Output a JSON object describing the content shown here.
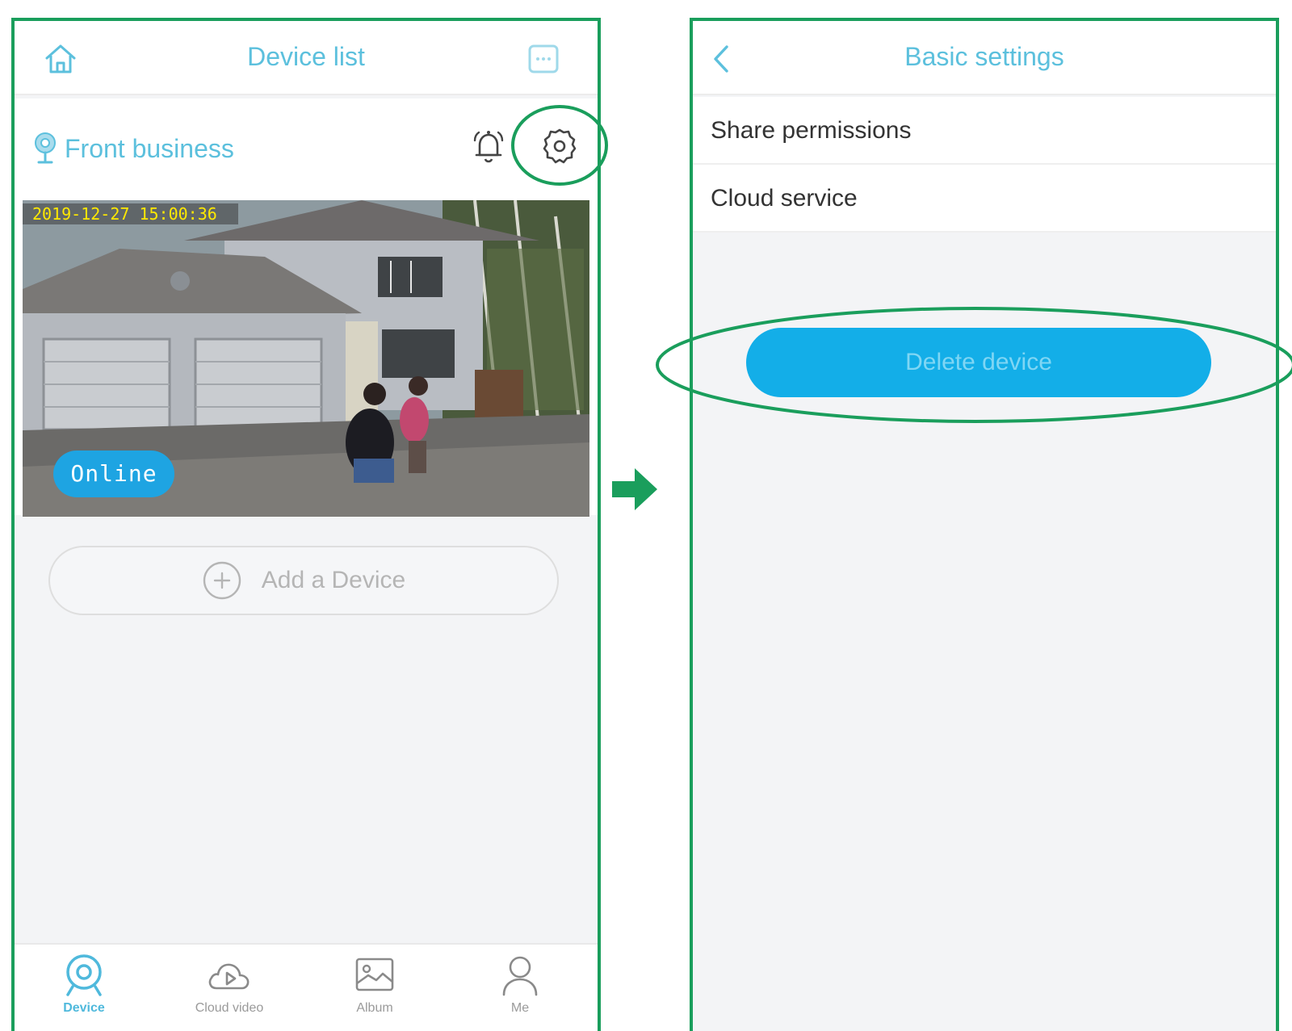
{
  "left_screen": {
    "header": {
      "title": "Device list"
    },
    "device": {
      "name": "Front business",
      "timestamp": "2019-12-27  15:00:36",
      "status": "Online"
    },
    "add_device_label": "Add a Device",
    "tabs": [
      {
        "label": "Device",
        "active": true
      },
      {
        "label": "Cloud video",
        "active": false
      },
      {
        "label": "Album",
        "active": false
      },
      {
        "label": "Me",
        "active": false
      }
    ]
  },
  "right_screen": {
    "header": {
      "title": "Basic settings"
    },
    "settings_items": [
      "Share permissions",
      "Cloud service"
    ],
    "delete_button_label": "Delete device"
  },
  "colors": {
    "accent": "#5cc0dd",
    "primary_button": "#13aee8",
    "annotation": "#1a9e5c",
    "timestamp": "#ffe900"
  }
}
